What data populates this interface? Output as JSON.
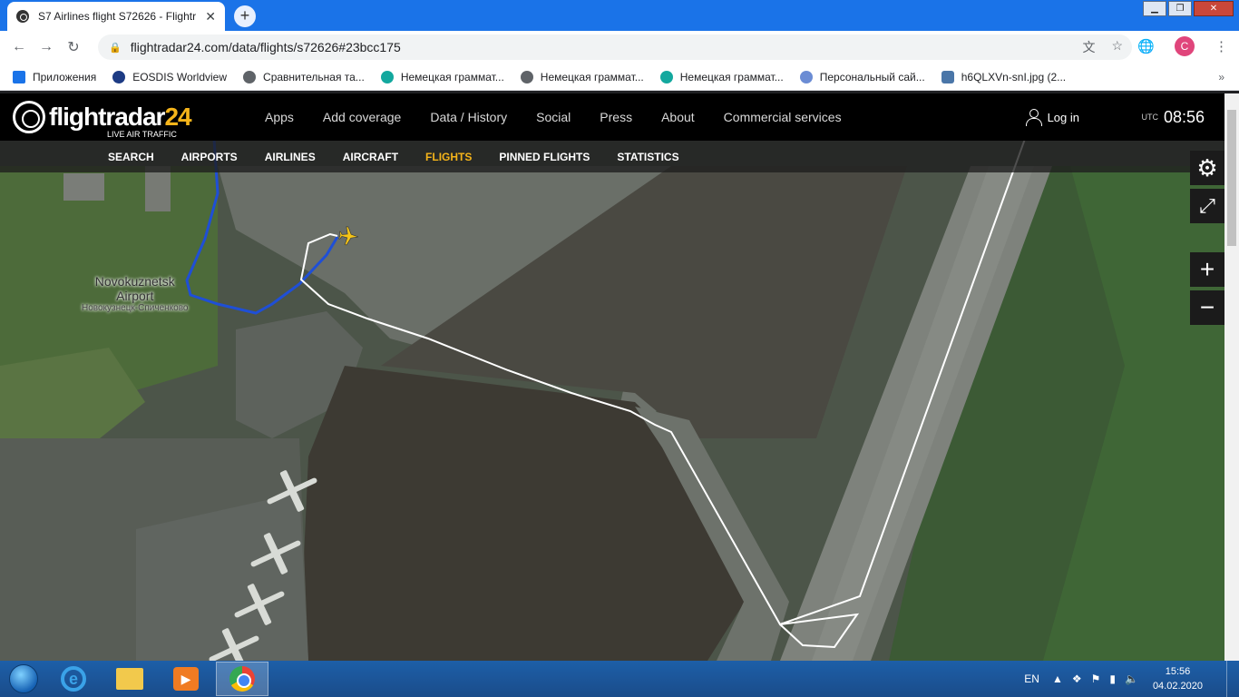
{
  "browser": {
    "tab_title": "S7 Airlines flight S72626 - Flightr",
    "tab_close": "✕",
    "new_tab": "+",
    "url": "flightradar24.com/data/flights/s72626#23bcc175",
    "profile_initial": "C",
    "window_controls": {
      "minimize": "▁",
      "restore": "❐",
      "close": "✕"
    },
    "toolbar_icons": {
      "back": "←",
      "forward": "→",
      "reload": "↻",
      "translate": "文",
      "star": "☆",
      "globe": "🌐",
      "menu": "⋮"
    }
  },
  "bookmarks": {
    "items": [
      {
        "label": "Приложения",
        "color": "#1a73e8"
      },
      {
        "label": "EOSDIS Worldview",
        "color": "#1d3b84"
      },
      {
        "label": "Сравнительная та...",
        "color": "#5f6368"
      },
      {
        "label": "Немецкая граммат...",
        "color": "#13a89e"
      },
      {
        "label": "Немецкая граммат...",
        "color": "#5f6368"
      },
      {
        "label": "Немецкая граммат...",
        "color": "#13a89e"
      },
      {
        "label": "Персональный сай...",
        "color": "#6b8cd4"
      },
      {
        "label": "h6QLXVn-snI.jpg (2...",
        "color": "#4a76a8"
      }
    ],
    "more": "»"
  },
  "fr24": {
    "logo_text": "flightradar",
    "logo_num": "24",
    "logo_sub": "LIVE AIR TRAFFIC",
    "nav": [
      "Apps",
      "Add coverage",
      "Data / History",
      "Social",
      "Press",
      "About",
      "Commercial services"
    ],
    "login": "Log in",
    "utc_label": "UTC",
    "time": "08:56",
    "subnav": [
      "SEARCH",
      "AIRPORTS",
      "AIRLINES",
      "AIRCRAFT",
      "FLIGHTS",
      "PINNED FLIGHTS",
      "STATISTICS"
    ],
    "active_subnav": "FLIGHTS",
    "settings_icon": "⚙",
    "fullscreen_icon": "⤢",
    "zoom_in": "+",
    "zoom_out": "−"
  },
  "map": {
    "airport_name_line1": "Novokuznetsk",
    "airport_name_line2": "Airport",
    "airport_local_name": "Новокузнецк-Спиченково",
    "track_color_blue": "#1f4fd6",
    "track_color_white": "#ffffff",
    "plane_color": "#f5c518"
  },
  "taskbar": {
    "language": "EN",
    "time": "15:56",
    "date": "04.02.2020",
    "tray_arrow": "▲",
    "ie_letter": "e",
    "media_icon": "▶"
  }
}
